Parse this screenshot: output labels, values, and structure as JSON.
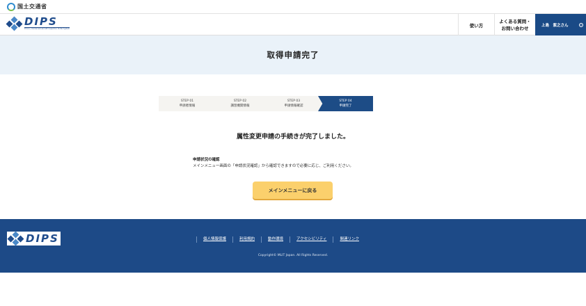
{
  "ministry": {
    "name": "国土交通省"
  },
  "header": {
    "logo_text": "DIPS",
    "logo_subtext": "Drone / Unmanned aircraft Inspection Portal System",
    "nav_usage": "使い方",
    "nav_faq_line1": "よくある質問・",
    "nav_faq_line2": "お問い合わせ",
    "user_name": "上島　紫之さん"
  },
  "page": {
    "title": "取得申請完了"
  },
  "steps": [
    {
      "step": "STEP 01",
      "label": "申請者情報"
    },
    {
      "step": "STEP 02",
      "label": "講習機関情報"
    },
    {
      "step": "STEP 03",
      "label": "申請情報確認"
    },
    {
      "step": "STEP 04",
      "label": "申請完了"
    }
  ],
  "main": {
    "complete_message": "属性変更申請の手続きが完了しました。",
    "info_title": "申請状況の確認",
    "info_text": "メインメニュー画面の「申請状況確認」から確認できますので必要に応じ、ご利用ください。",
    "menu_button": "メインメニューに戻る"
  },
  "footer": {
    "logo_text": "DIPS",
    "links": [
      "個人情報保護",
      "利用規約",
      "動作環境",
      "アクセシビリティ",
      "関連リンク"
    ],
    "copyright": "Copyright© MLIT Japan. All Rights Reserved."
  },
  "colors": {
    "primary": "#1d4a87",
    "title_band": "#eaf2f9",
    "button": "#fbd06c"
  }
}
